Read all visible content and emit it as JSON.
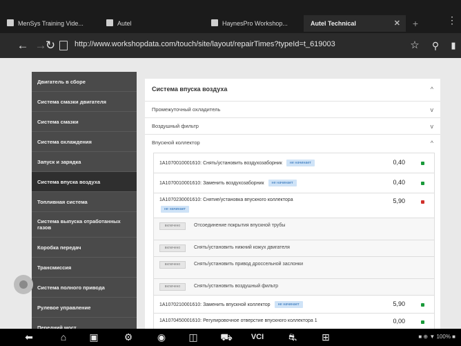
{
  "browser": {
    "tabs": [
      {
        "label": "MenSys Training Vide...",
        "active": false
      },
      {
        "label": "Autel",
        "active": false
      },
      {
        "label": "HaynesPro Workshop...",
        "active": false
      },
      {
        "label": "Autel Technical",
        "active": true
      }
    ],
    "new_tab_symbol": "+",
    "menu_symbol": "⋮",
    "url": "http://www.workshopdata.com/touch/site/layout/repairTimes?typeId=t_619003"
  },
  "sidebar": {
    "items": [
      {
        "label": "Двигатель в сборе",
        "active": false
      },
      {
        "label": "Система смазки двигателя",
        "active": false
      },
      {
        "label": "Система смазки",
        "active": false
      },
      {
        "label": "Система охлаждения",
        "active": false
      },
      {
        "label": "Запуск и зарядка",
        "active": false
      },
      {
        "label": "Система впуска воздуха",
        "active": true
      },
      {
        "label": "Топливная система",
        "active": false
      },
      {
        "label": "Система выпуска отработанных газов",
        "active": false
      },
      {
        "label": "Коробка передач",
        "active": false
      },
      {
        "label": "Трансмиссия",
        "active": false
      },
      {
        "label": "Система полного привода",
        "active": false
      },
      {
        "label": "Рулевое управление",
        "active": false
      },
      {
        "label": "Передний мост",
        "active": false
      }
    ]
  },
  "panel": {
    "title": "Система впуска воздуха",
    "collapse_symbol": "^",
    "sections": [
      {
        "label": "Промежуточный охладитель",
        "chevron": "v"
      },
      {
        "label": "Воздушный фильтр",
        "chevron": "v"
      },
      {
        "label": "Впускной коллектор",
        "chevron": "^"
      }
    ],
    "jobs": [
      {
        "code": "1A1070010001610",
        "text": "Снять/установить воздухозаборник",
        "badge": "не начинает",
        "value": "0,40",
        "status_color": "#1a9a3a"
      },
      {
        "code": "1A1070010001610",
        "text": "Заменить воздухозаборник",
        "badge": "не начинает",
        "value": "0,40",
        "status_color": "#1a9a3a"
      },
      {
        "code": "1A1070230001610",
        "text": "Снятие/установка впускного коллектора",
        "badge": "не начинает",
        "value": "5,90",
        "status_color": "#d0302b"
      }
    ],
    "sub_items": [
      {
        "button": "включено",
        "text": "Отсоединение покрытия впускной трубы"
      },
      {
        "button": "включено",
        "text": "Снять/установить нижний кожух двигателя"
      },
      {
        "button": "включено",
        "text": "Снять/установить привод дроссельной заслонки"
      },
      {
        "button": "включено",
        "text": "Снять/установить воздушный фильтр"
      }
    ],
    "jobs_bottom": [
      {
        "code": "1A1070210001610",
        "text": "Заменить впускной коллектор",
        "badge": "не начинает",
        "value": "5,90",
        "status_color": "#1a9a3a"
      },
      {
        "code": "1A1070450001610",
        "text": "Регулировочное отверстие впускного коллектора 1",
        "badge": "",
        "value": "0,00",
        "status_color": "#1a9a3a"
      }
    ]
  },
  "android_nav": {
    "buttons": [
      {
        "name": "back-icon",
        "glyph": "⬅"
      },
      {
        "name": "home-icon",
        "glyph": "⌂"
      },
      {
        "name": "recent-apps-icon",
        "glyph": "▣"
      },
      {
        "name": "settings-icon",
        "glyph": "⚙"
      },
      {
        "name": "camera-icon",
        "glyph": "◉"
      },
      {
        "name": "windows-icon",
        "glyph": "◫"
      },
      {
        "name": "car-icon",
        "glyph": "⛟"
      },
      {
        "name": "vci-icon",
        "glyph": "VCI"
      },
      {
        "name": "diagnostic-car-icon",
        "glyph": "⛐"
      },
      {
        "name": "network-icon",
        "glyph": "⊞"
      }
    ],
    "status": "■ ⊕ ▼ 100% ■"
  }
}
